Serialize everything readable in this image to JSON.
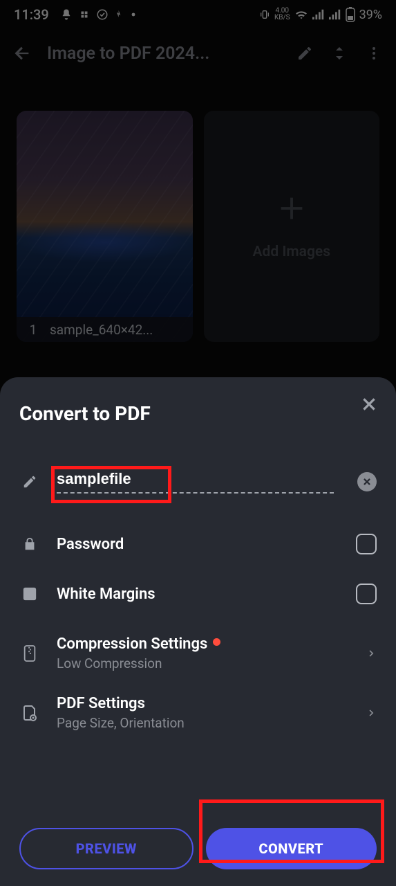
{
  "status": {
    "time": "11:39",
    "data_rate": "4.00",
    "data_unit": "KB/S",
    "battery": "39%"
  },
  "toolbar": {
    "title": "Image to PDF 2024..."
  },
  "images": [
    {
      "index": "1",
      "name": "sample_640×42..."
    }
  ],
  "add_card": {
    "label": "Add Images"
  },
  "sheet": {
    "title": "Convert to PDF",
    "filename": "samplefile",
    "password_label": "Password",
    "margins_label": "White Margins",
    "compression_label": "Compression Settings",
    "compression_sub": "Low Compression",
    "pdf_label": "PDF Settings",
    "pdf_sub": "Page Size, Orientation",
    "preview_btn": "PREVIEW",
    "convert_btn": "CONVERT"
  }
}
